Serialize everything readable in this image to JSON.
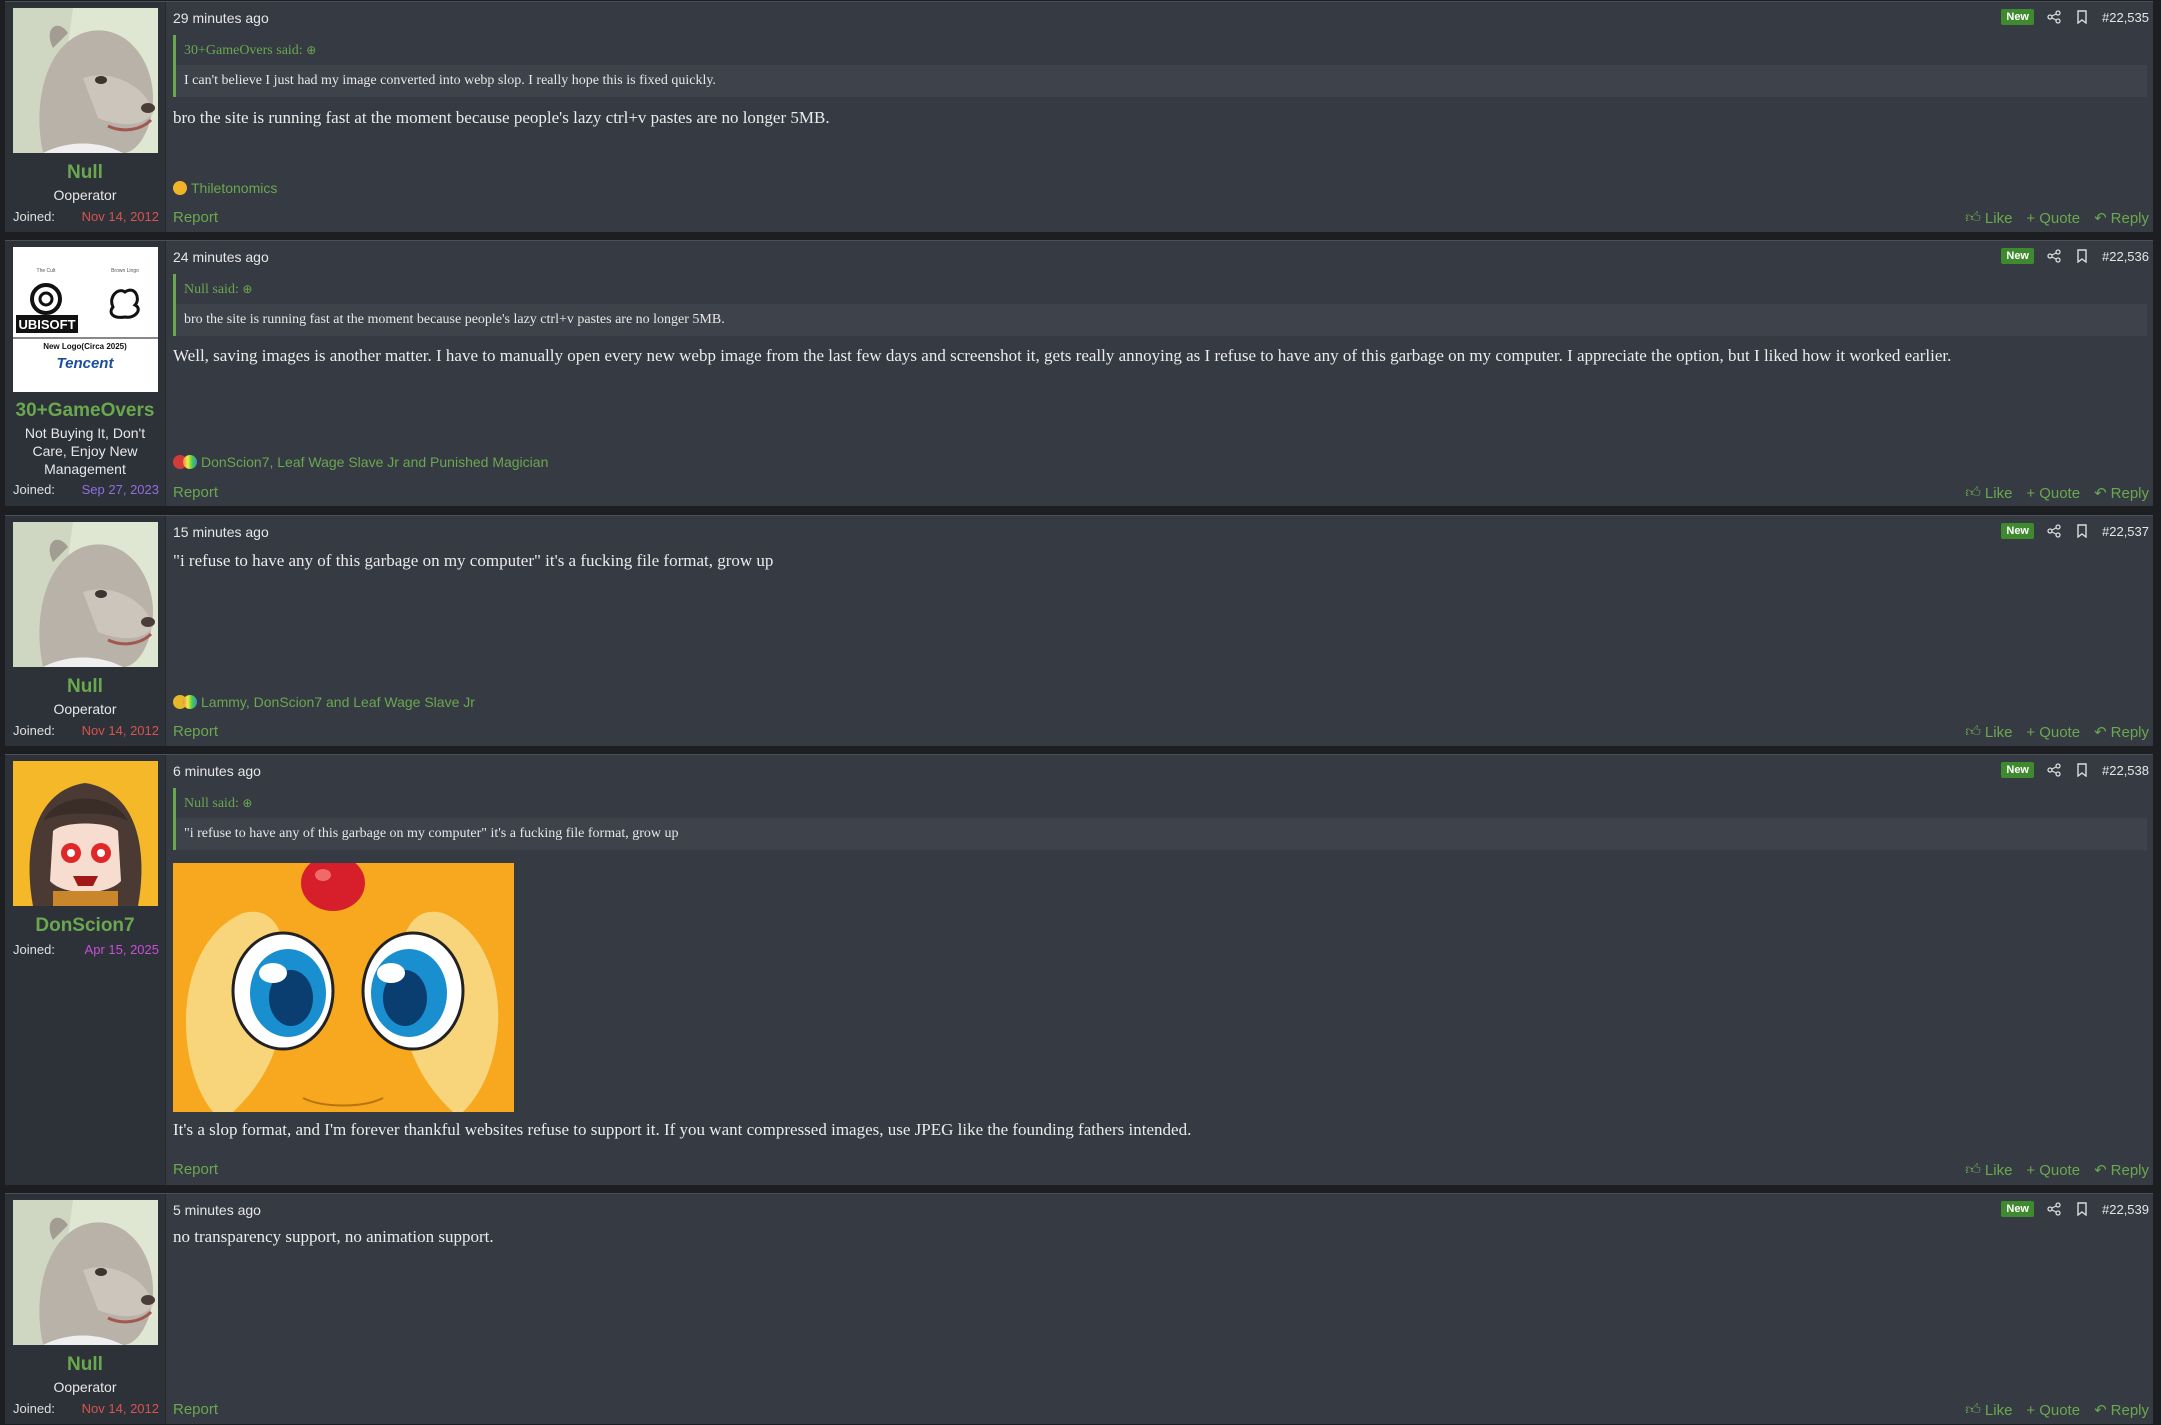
{
  "common": {
    "new_badge": "New",
    "report_label": "Report",
    "like_label": "Like",
    "quote_label": "Quote",
    "reply_label": "Reply",
    "joined_label": "Joined:"
  },
  "posts": [
    {
      "username": "Null",
      "user_title": "Ooperator",
      "joined": "Nov 14, 2012",
      "time": "29 minutes ago",
      "number": "#22,535",
      "quote_author": "30+GameOvers said:",
      "quote_text": "I can't believe I just had my image converted into webp slop. I really hope this is fixed quickly.",
      "body": "bro the site is running fast at the moment because people's lazy ctrl+v pastes are no longer 5MB.",
      "reactions": "Thiletonomics"
    },
    {
      "username": "30+GameOvers",
      "user_title": "Not Buying It, Don't Care, Enjoy New Management",
      "joined": "Sep 27, 2023",
      "time": "24 minutes ago",
      "number": "#22,536",
      "quote_author": "Null said:",
      "quote_text": "bro the site is running fast at the moment because people's lazy ctrl+v pastes are no longer 5MB.",
      "body": "Well, saving images is another matter. I have to manually open every new webp image from the last few days and screenshot it, gets really annoying as I refuse to have any of this garbage on my computer. I appreciate the option, but I liked how it worked earlier.",
      "reactions": "DonScion7, Leaf Wage Slave Jr and Punished Magician",
      "avatar_text": {
        "left_caption": "The Cult",
        "right_caption": "Brown Lingo",
        "brand": "UBISOFT",
        "new_logo": "New Logo(Circa 2025)",
        "tencent": "Tencent"
      }
    },
    {
      "username": "Null",
      "user_title": "Ooperator",
      "joined": "Nov 14, 2012",
      "time": "15 minutes ago",
      "number": "#22,537",
      "body": "\"i refuse to have any of this garbage on my computer\" it's a fucking file format, grow up",
      "reactions": "Lammy, DonScion7 and Leaf Wage Slave Jr"
    },
    {
      "username": "DonScion7",
      "joined": "Apr 15, 2025",
      "time": "6 minutes ago",
      "number": "#22,538",
      "quote_author": "Null said:",
      "quote_text": "\"i refuse to have any of this garbage on my computer\" it's a fucking file format, grow up",
      "body": "It's a slop format, and I'm forever thankful websites refuse to support it. If you want compressed images, use JPEG like the founding fathers intended."
    },
    {
      "username": "Null",
      "user_title": "Ooperator",
      "joined": "Nov 14, 2012",
      "time": "5 minutes ago",
      "number": "#22,539",
      "body": "no transparency support, no animation support."
    }
  ],
  "colors": {
    "accent": "#6aa84f",
    "joined_red": "#d9534f",
    "joined_purple": "#8f6fe0",
    "joined_magenta": "#c84fd8"
  }
}
